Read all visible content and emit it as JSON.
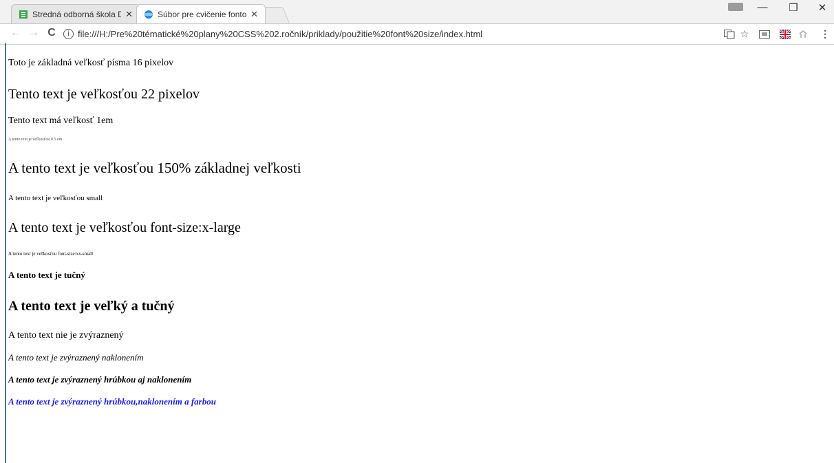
{
  "tabs": [
    {
      "title": "Stredná odborná škola D",
      "close": "✕",
      "active": false,
      "favicon_color": "#3aa64a"
    },
    {
      "title": "Súbor pre cvičenie fonto",
      "close": "✕",
      "active": true,
      "favicon_color": "#1e88e5"
    }
  ],
  "window_controls": {
    "minimize": "—",
    "restore": "❐",
    "close": "✕"
  },
  "toolbar": {
    "back": "←",
    "forward": "→",
    "reload": "C",
    "info": "i",
    "url": "file:///H:/Pre%20tématické%20plany%20CSS%202.ročník/priklady/použitie%20font%20size/index.html",
    "translate_icon": "translate-icon",
    "star": "☆",
    "menu": "⋮"
  },
  "content": {
    "line_base": "Toto je základná veľkosť písma 16 pixelov",
    "line_22px": "Tento text je veľkosťou 22 pixelov",
    "line_1em": "Tento text má veľkosť 1em",
    "line_05em": "A tento text je veľkosťou 0.5 em",
    "line_150pct": "A tento text je veľkosťou 150% základnej veľkosti",
    "line_small": "A tento text je veľkosťou small",
    "line_xlarge": "A tento text je veľkosťou font-size:x-large",
    "line_xxsmall": "A tento text je veľkosťou font-size:xx-small",
    "line_bold": "A tento text je tučný",
    "line_big_bold": "A tento text je veľký a tučný",
    "line_normal": "A tento text nie je zvýraznený",
    "line_italic": "A tento text je zvýraznený naklonením",
    "line_bold_italic": "A tento text je zvýraznený hrúbkou aj naklonením",
    "line_bold_italic_color": "A tento text je zvýraznený hrúbkou,naklonením a farbou",
    "accent_color": "#1a1aff"
  }
}
